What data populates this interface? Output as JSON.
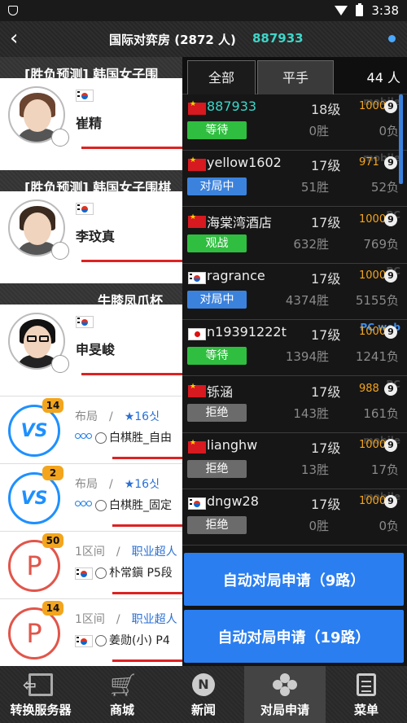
{
  "status_bar": {
    "time": "3:38"
  },
  "appbar": {
    "title": "国际对弈房 (2872 人)",
    "room_id": "887933"
  },
  "featured": [
    {
      "title": "[胜负预测] 韩国女子围",
      "player": "崔精"
    },
    {
      "title": "[胜负预测] 韩国女子围棋",
      "player": "李玟真"
    },
    {
      "title": "牛膝凤爪杯",
      "player": "申旻峻"
    }
  ],
  "games": [
    {
      "ring": "VS",
      "badge": "14",
      "l1a": "布局",
      "l1b": "★16싯",
      "l2": "白棋胜_自由"
    },
    {
      "ring": "VS",
      "badge": "2",
      "l1a": "布局",
      "l1b": "★16싯",
      "l2": "白棋胜_固定"
    },
    {
      "ring": "P",
      "badge": "50",
      "l1a": "1区间",
      "l1b": "职业超人",
      "l2": "朴常鎭 P5段"
    },
    {
      "ring": "P",
      "badge": "14",
      "l1a": "1区间",
      "l1b": "职业超人",
      "l2": "姜勋(小) P4"
    }
  ],
  "panel": {
    "tab_all": "全部",
    "tab_even": "平手",
    "count": "44 人",
    "players": [
      {
        "flag": "cn",
        "name": "887933",
        "rank": "18级",
        "elo": "1000",
        "nine": "9",
        "status": "等待",
        "wins": "0胜",
        "losses": "0负",
        "platform": "mobile"
      },
      {
        "flag": "cn",
        "name": "yellow1602",
        "rank": "17级",
        "elo": "971",
        "nine": "9",
        "status": "对局中",
        "wins": "51胜",
        "losses": "52负",
        "platform": "mobile"
      },
      {
        "flag": "cn",
        "name": "海棠湾酒店",
        "rank": "17级",
        "elo": "1000",
        "nine": "9",
        "status": "观战",
        "wins": "632胜",
        "losses": "769负",
        "platform": "PC"
      },
      {
        "flag": "kr",
        "name": "ragrance",
        "rank": "17级",
        "elo": "1000",
        "nine": "9",
        "status": "对局中",
        "wins": "4374胜",
        "losses": "5155负",
        "platform": "PC"
      },
      {
        "flag": "jp",
        "name": "n19391222t",
        "rank": "17级",
        "elo": "1000",
        "nine": "9",
        "status": "等待",
        "wins": "1394胜",
        "losses": "1241负",
        "platform": "PC web"
      },
      {
        "flag": "cn",
        "name": "铄涵",
        "rank": "17级",
        "elo": "988",
        "nine": "9",
        "status": "拒绝",
        "wins": "143胜",
        "losses": "161负",
        "platform": "PC"
      },
      {
        "flag": "cn",
        "name": "lianghw",
        "rank": "17级",
        "elo": "1000",
        "nine": "9",
        "status": "拒绝",
        "wins": "13胜",
        "losses": "17负",
        "platform": "mobile"
      },
      {
        "flag": "kr",
        "name": "dngw28",
        "rank": "17级",
        "elo": "1000",
        "nine": "9",
        "status": "拒绝",
        "wins": "0胜",
        "losses": "0负",
        "platform": "mobile"
      }
    ],
    "auto9": "自动对局申请（9路）",
    "auto19": "自动对局申请（19路）"
  },
  "nav": [
    {
      "label": "转换服务器",
      "icon": "switch-server-icon"
    },
    {
      "label": "商城",
      "icon": "cart-icon"
    },
    {
      "label": "新闻",
      "icon": "news-icon",
      "glyph": "N"
    },
    {
      "label": "对局申请",
      "icon": "game-request-icon"
    },
    {
      "label": "菜单",
      "icon": "menu-icon"
    }
  ]
}
